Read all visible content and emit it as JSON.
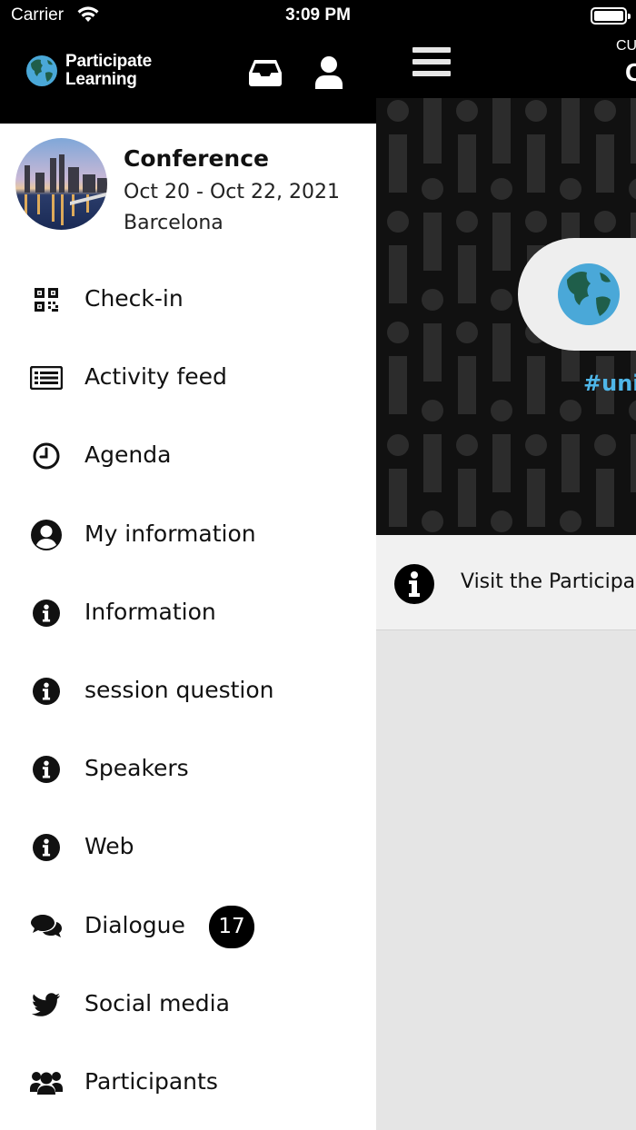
{
  "status_bar": {
    "carrier": "Carrier",
    "time": "3:09 PM"
  },
  "brand": {
    "name_line1": "Participate",
    "name_line2": "Learning"
  },
  "event": {
    "title": "Conference",
    "dates": "Oct 20 - Oct 22, 2021",
    "location": "Barcelona"
  },
  "menu": {
    "items": [
      {
        "label": "Check-in",
        "icon": "qr-code-icon"
      },
      {
        "label": "Activity feed",
        "icon": "newspaper-icon"
      },
      {
        "label": "Agenda",
        "icon": "clock-icon"
      },
      {
        "label": "My information",
        "icon": "user-circle-icon"
      },
      {
        "label": "Information",
        "icon": "info-icon"
      },
      {
        "label": "session question",
        "icon": "info-icon"
      },
      {
        "label": "Speakers",
        "icon": "info-icon"
      },
      {
        "label": "Web",
        "icon": "info-icon"
      },
      {
        "label": "Dialogue",
        "icon": "comments-icon",
        "badge": "17"
      },
      {
        "label": "Social media",
        "icon": "twitter-icon"
      },
      {
        "label": "Participants",
        "icon": "users-icon"
      }
    ]
  },
  "main": {
    "top_right_small": "CU",
    "top_right_large": "C",
    "hero_hashtag": "#uni",
    "info_banner": "Visit the Participa"
  },
  "colors": {
    "accent_blue": "#4fb6e8",
    "globe_ocean": "#4aa8d8",
    "globe_land": "#1f5e4a",
    "badge_bg": "#000000"
  }
}
